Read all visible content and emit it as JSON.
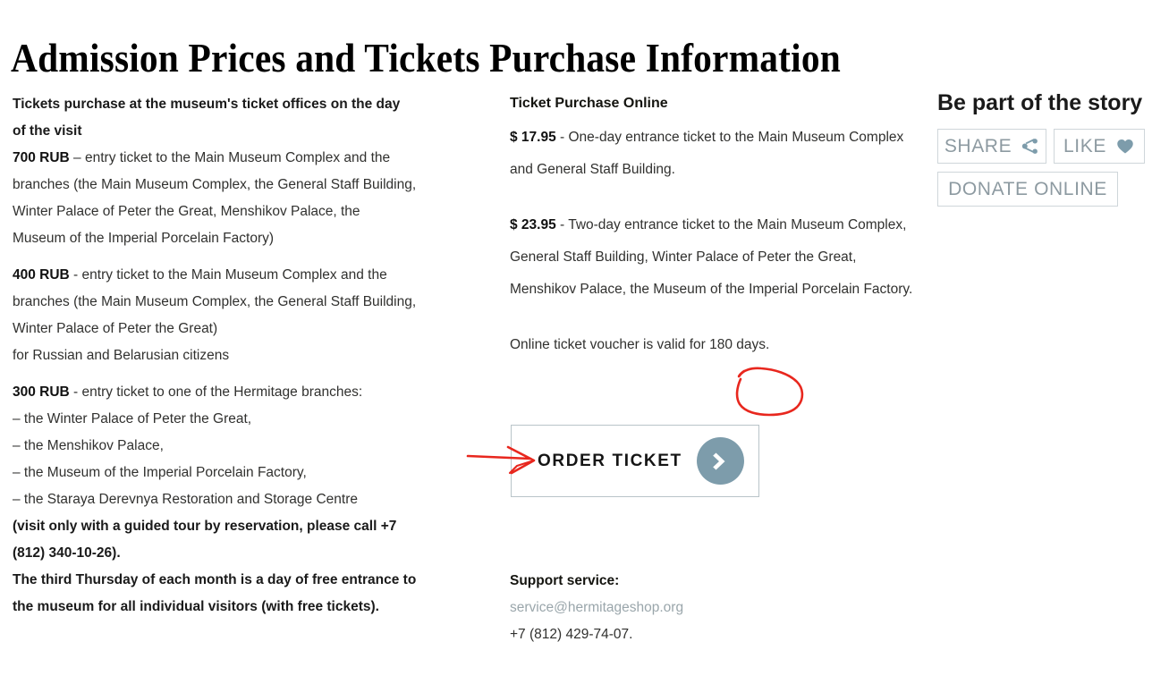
{
  "page": {
    "title": "Admission Prices and Tickets Purchase Information"
  },
  "left_column": {
    "heading": "Tickets purchase at the museum's ticket offices on the day of the visit",
    "blocks": [
      {
        "price": "700 RUB",
        "separator": " – ",
        "text": "entry ticket to the Main Museum Complex and the branches (the Main Museum Complex, the General Staff Building, Winter Palace of Peter the Great, Menshikov Palace, the Museum of the Imperial Porcelain Factory)"
      },
      {
        "price": "400 RUB",
        "separator": " - ",
        "text": "entry ticket to the Main Museum Complex and the branches (the Main Museum Complex, the General Staff Building, Winter Palace of Peter the Great)",
        "extra_line": "for Russian and Belarusian citizens"
      },
      {
        "price": "300 RUB",
        "separator": " - ",
        "text": "entry ticket to one of the Hermitage branches:",
        "list": [
          "– the Winter Palace of Peter the Great,",
          "– the Menshikov Palace,",
          "– the Museum of the Imperial Porcelain Factory,",
          "– the Staraya Derevnya Restoration and Storage Centre"
        ],
        "note": "(visit only with a guided tour by reservation, please call +7 (812) 340-10-26)."
      }
    ],
    "free_entrance_note": "The third Thursday of each month is a day of free entrance to the museum for all individual visitors (with free tickets)."
  },
  "mid_column": {
    "heading": "Ticket Purchase Online",
    "offers": [
      {
        "price": "$ 17.95",
        "separator": " - ",
        "text": "One-day entrance ticket to the Main Museum Complex and General Staff Building."
      },
      {
        "price": "$ 23.95",
        "separator": " - ",
        "text": "Two-day entrance ticket to the Main Museum Complex, General Staff Building, Winter Palace of Peter the Great, Menshikov Palace, the Museum of the Imperial Porcelain Factory."
      }
    ],
    "voucher_note": "Online ticket voucher is valid for 180 days.",
    "voucher_highlight": "180 days",
    "order_button": {
      "label": "ORDER  TICKET",
      "icon": "chevron-right-icon",
      "icon_circle_color": "#7d9cab"
    },
    "support": {
      "title": "Support service:",
      "email": "service@hermitageshop.org",
      "phone": "+7 (812) 429-74-07."
    }
  },
  "right_column": {
    "title": "Be part of the story",
    "buttons": [
      {
        "label": "SHARE",
        "icon": "share-icon"
      },
      {
        "label": "LIKE",
        "icon": "heart-icon"
      },
      {
        "label": "DONATE ONLINE",
        "icon": "none"
      }
    ],
    "icon_color": "#7d9cab",
    "text_color": "#8d9aa1"
  },
  "annotations": {
    "circle_target": "180 days",
    "arrow_target": "ORDER TICKET button",
    "color": "#e8271e"
  }
}
